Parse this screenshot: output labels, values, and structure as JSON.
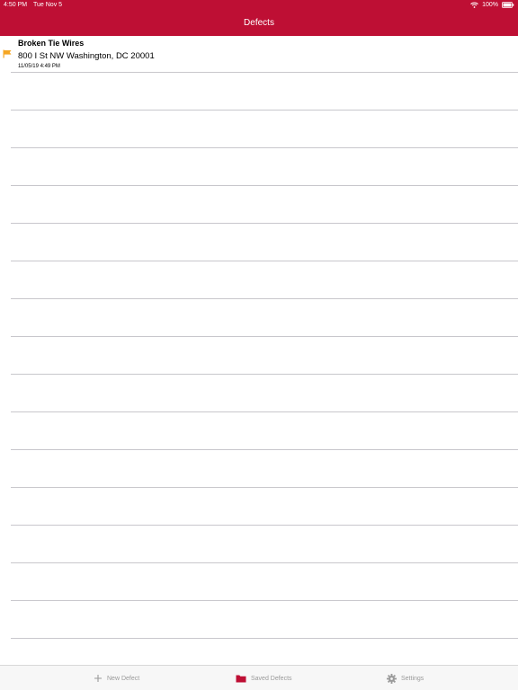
{
  "status_bar": {
    "time": "4:50 PM",
    "date": "Tue Nov 5",
    "battery": "100%",
    "icons": [
      "wifi-icon",
      "battery-icon"
    ]
  },
  "header": {
    "title": "Defects",
    "color": "#be0f34"
  },
  "defects": [
    {
      "title": "Broken Tie Wires",
      "address": "800 I St NW Washington, DC 20001",
      "timestamp": "11/05/19 4:49 PM",
      "icon": "flag-icon",
      "flag_color": "#f5a623"
    }
  ],
  "tabbar": {
    "items": [
      {
        "label": "New Defect",
        "icon": "plus-icon",
        "active": false
      },
      {
        "label": "Saved Defects",
        "icon": "folder-icon",
        "active": true,
        "color": "#be0f34"
      },
      {
        "label": "Settings",
        "icon": "gear-icon",
        "active": false
      }
    ]
  }
}
